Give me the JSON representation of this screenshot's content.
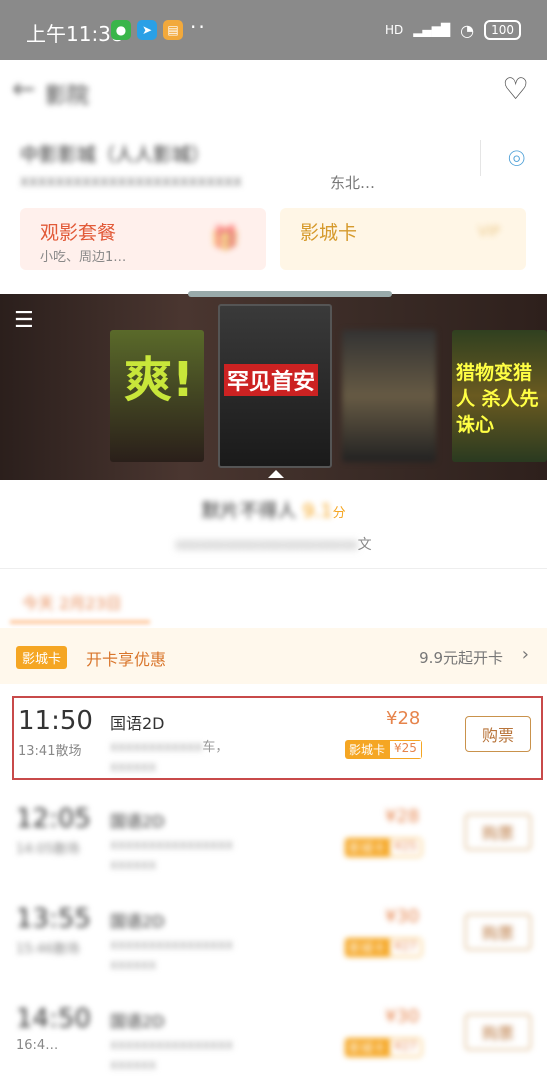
{
  "status_bar": {
    "time": "上午11:38",
    "battery": "100",
    "network": "HD"
  },
  "header": {
    "back_label": "←",
    "title": "影院"
  },
  "cinema": {
    "name": "中影影城（人人影城）",
    "address": "xxxxxxxxxxxxxxxxxxxxxxxxx",
    "address_tail": "东北…"
  },
  "cards": [
    {
      "title": "观影套餐",
      "subtitle": "小吃、周边1…"
    },
    {
      "title": "影城卡",
      "subtitle": ""
    }
  ],
  "posters": [
    {
      "caption": "爽!"
    },
    {
      "caption": "罕见首安"
    },
    {
      "caption": ""
    },
    {
      "caption": "猎物变猎人 杀人先诛心"
    }
  ],
  "movie": {
    "title": "默片不得人",
    "score": "9.1",
    "score_unit": "分",
    "info_tail": "文"
  },
  "date_tab": "今天 2月23日",
  "promo": {
    "badge": "影城卡",
    "text": "开卡享优惠",
    "right": "9.9元起开卡"
  },
  "showtimes": [
    {
      "start": "11:50",
      "end": "13:41散场",
      "lang": "国语2D",
      "hall": "车，",
      "hall2": "",
      "price": "¥28",
      "card_label": "影城卡",
      "card_price": "¥25",
      "buy": "购票"
    },
    {
      "start": "12:05",
      "end": "14:05散场",
      "lang": "国语2D",
      "hall": "",
      "hall2": "",
      "price": "¥28",
      "card_label": "影城卡",
      "card_price": "¥25",
      "buy": "购票"
    },
    {
      "start": "13:55",
      "end": "15:46散场",
      "lang": "国语2D",
      "hall": "",
      "hall2": "",
      "price": "¥30",
      "card_label": "影城卡",
      "card_price": "¥27",
      "buy": "购票"
    },
    {
      "start": "14:50",
      "end": "16:4…",
      "lang": "国语2D",
      "hall": "",
      "hall2": "",
      "price": "¥30",
      "card_label": "影城卡",
      "card_price": "¥27",
      "buy": "购票"
    }
  ]
}
